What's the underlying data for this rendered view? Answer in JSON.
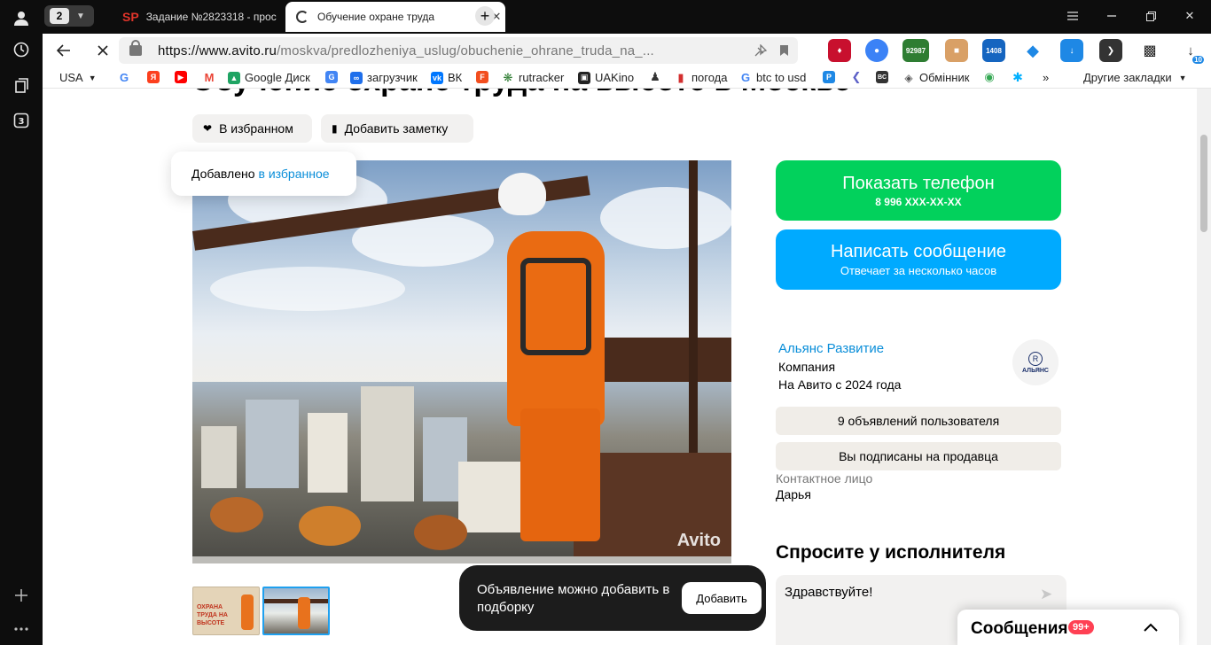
{
  "browser": {
    "tab_count": "2",
    "tabs": [
      {
        "favicon": "SP",
        "title": "Задание №2823318 - прос"
      },
      {
        "title": "Обучение охране труда"
      }
    ],
    "url_domain": "https://www.avito.ru",
    "url_path": "/moskva/predlozheniya_uslug/obuchenie_ohrane_truda_na_...",
    "extensions": {
      "badge_1": "92987",
      "badge_2": "1408",
      "downloads": "10"
    },
    "bookmarks": [
      {
        "label": "USA",
        "icon": "dropdown",
        "color": "#000000"
      },
      {
        "label": "",
        "icon": "google-icon",
        "color": "#4285f4"
      },
      {
        "label": "",
        "icon": "yandex-icon",
        "color": "#fc3f1d"
      },
      {
        "label": "",
        "icon": "youtube-icon",
        "color": "#ff0000"
      },
      {
        "label": "",
        "icon": "gmail-icon",
        "color": "#ea4335"
      },
      {
        "label": "Google Диск",
        "icon": "google-drive-icon",
        "color": "#1fa463"
      },
      {
        "label": "",
        "icon": "translate-icon",
        "color": "#4285f4"
      },
      {
        "label": "загрузчик",
        "icon": "loader-icon",
        "color": "#1f6feb"
      },
      {
        "label": "ВК",
        "icon": "vk-icon",
        "color": "#0077ff"
      },
      {
        "label": "",
        "icon": "figma-icon",
        "color": "#f24e1e"
      },
      {
        "label": "rutracker",
        "icon": "rutracker-icon",
        "color": "#2e7d32"
      },
      {
        "label": "UAKino",
        "icon": "uakino-icon",
        "color": "#222222"
      },
      {
        "label": "",
        "icon": "chess-icon",
        "color": "#333333"
      },
      {
        "label": "погода",
        "icon": "thermometer-icon",
        "color": "#d32f2f"
      },
      {
        "label": "btc to usd",
        "icon": "google-icon",
        "color": "#4285f4"
      },
      {
        "label": "",
        "icon": "p-icon",
        "color": "#1e88e5"
      },
      {
        "label": "",
        "icon": "diamond-icon",
        "color": "#5b5fc7"
      },
      {
        "label": "",
        "icon": "bc-icon",
        "color": "#333333"
      },
      {
        "label": "Обмінник",
        "icon": "exchange-icon",
        "color": "#555555"
      },
      {
        "label": "",
        "icon": "maps-icon",
        "color": "#34a853"
      },
      {
        "label": "",
        "icon": "star-icon",
        "color": "#00b0ff"
      }
    ],
    "other_bookmarks": "Другие закладки",
    "more_bookmarks": "»"
  },
  "page": {
    "heading_cut": "Обучение охране труда на высоте в Москве",
    "favorite_button": "В избранном",
    "note_button": "Добавить заметку",
    "popup_text": "Добавлено",
    "popup_link": "в избранное",
    "watermark": "Avito",
    "thumb1_text": "ОХРАНА ТРУДА НА ВЫСОТЕ",
    "phone_button": "Показать телефон",
    "phone_number": "8 996 XXX-XX-XX",
    "message_button": "Написать сообщение",
    "message_sub": "Отвечает за несколько часов",
    "seller_name": "Альянс Развитие",
    "seller_type": "Компания",
    "seller_since": "На Авито с 2024 года",
    "seller_logo_mono": "R",
    "seller_logo_text": "АЛЬЯНС",
    "user_ads_button": "9 объявлений пользователя",
    "subscribed_button": "Вы подписаны на продавца",
    "contact_label": "Контактное лицо",
    "contact_name": "Дарья",
    "ask_title": "Спросите у исполнителя",
    "ask_text": "Здравствуйте!",
    "toast_text": "Объявление можно добавить в подборку",
    "toast_button": "Добавить",
    "messages_label": "Сообщения",
    "messages_badge": "99+"
  },
  "colors": {
    "phone_green": "#02d15c",
    "message_blue": "#00aaff",
    "link_blue": "#0a8ed9",
    "badge_red": "#ff4053"
  }
}
